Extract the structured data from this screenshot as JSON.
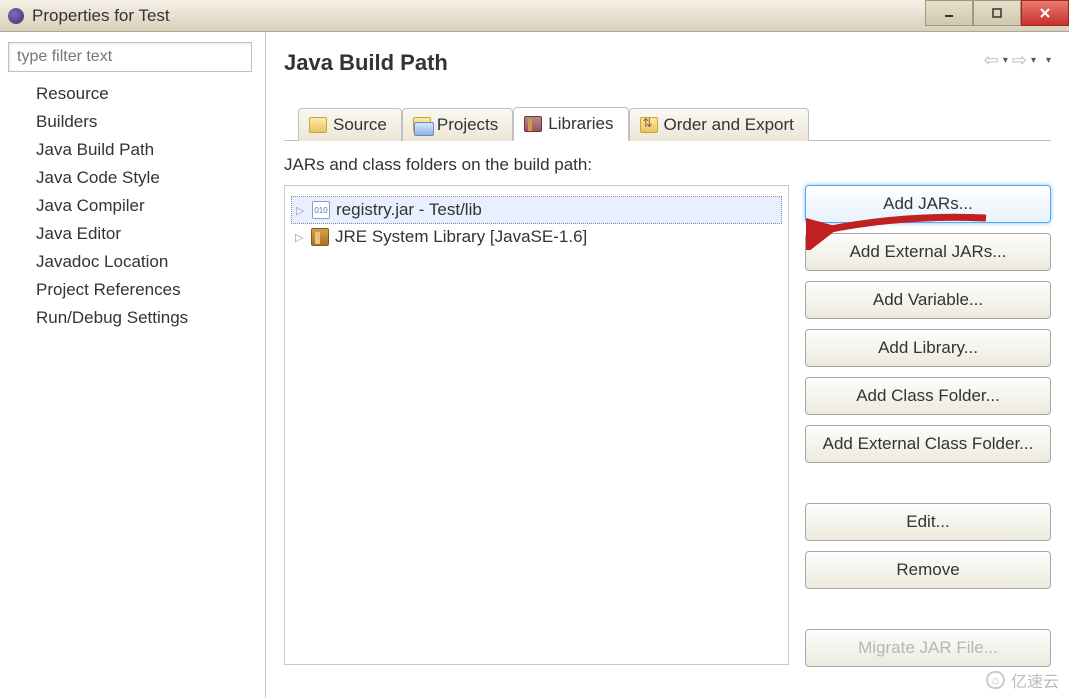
{
  "window": {
    "title": "Properties for Test"
  },
  "sidebar": {
    "filter_placeholder": "type filter text",
    "items": [
      "Resource",
      "Builders",
      "Java Build Path",
      "Java Code Style",
      "Java Compiler",
      "Java Editor",
      "Javadoc Location",
      "Project References",
      "Run/Debug Settings"
    ],
    "selected_index": 2
  },
  "main": {
    "title": "Java Build Path",
    "tabs": [
      {
        "label": "Source",
        "icon": "folder"
      },
      {
        "label": "Projects",
        "icon": "folder-open"
      },
      {
        "label": "Libraries",
        "icon": "library"
      },
      {
        "label": "Order and Export",
        "icon": "order"
      }
    ],
    "active_tab_index": 2,
    "content_heading": "JARs and class folders on the build path:",
    "entries": [
      {
        "label": "registry.jar - Test/lib",
        "icon": "jar",
        "selected": true
      },
      {
        "label": "JRE System Library [JavaSE-1.6]",
        "icon": "jre",
        "selected": false
      }
    ],
    "buttons": [
      {
        "label": "Add JARs...",
        "state": "highlight"
      },
      {
        "label": "Add External JARs...",
        "state": "normal"
      },
      {
        "label": "Add Variable...",
        "state": "normal"
      },
      {
        "label": "Add Library...",
        "state": "normal"
      },
      {
        "label": "Add Class Folder...",
        "state": "normal"
      },
      {
        "label": "Add External Class Folder...",
        "state": "normal"
      },
      {
        "label": "Edit...",
        "state": "normal",
        "gap_before": true
      },
      {
        "label": "Remove",
        "state": "normal"
      },
      {
        "label": "Migrate JAR File...",
        "state": "disabled",
        "gap_before": true
      }
    ]
  },
  "watermark": "亿速云"
}
